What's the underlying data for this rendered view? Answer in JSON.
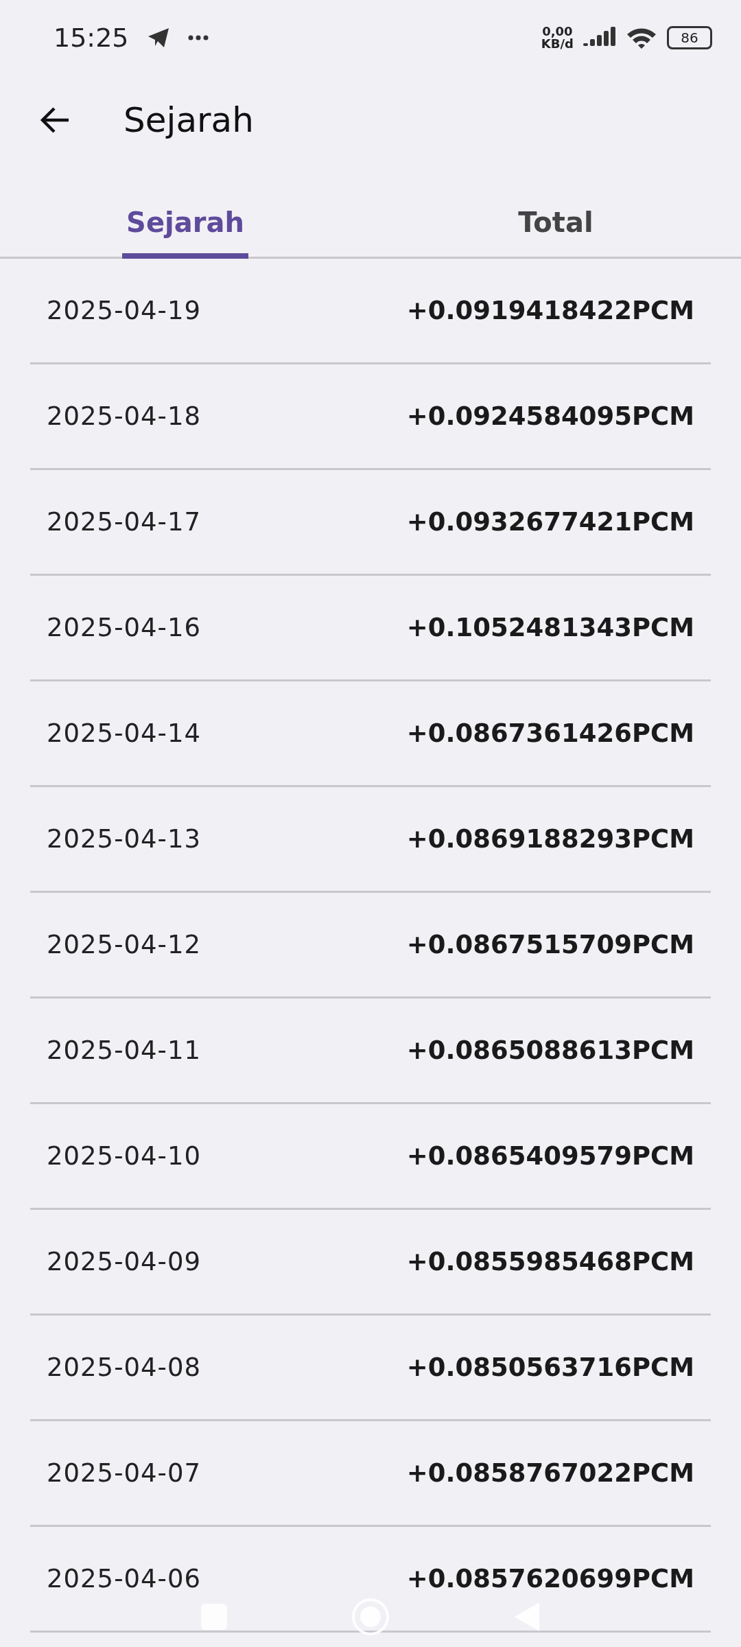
{
  "status_bar": {
    "time": "15:25",
    "net_speed": "0,00",
    "net_unit": "KB/d",
    "battery": "86"
  },
  "header": {
    "title": "Sejarah"
  },
  "tabs": [
    {
      "label": "Sejarah",
      "selected": true
    },
    {
      "label": "Total",
      "selected": false
    }
  ],
  "rows": [
    {
      "date": "2025-04-19",
      "amount": "+0.0919418422PCM"
    },
    {
      "date": "2025-04-18",
      "amount": "+0.0924584095PCM"
    },
    {
      "date": "2025-04-17",
      "amount": "+0.0932677421PCM"
    },
    {
      "date": "2025-04-16",
      "amount": "+0.1052481343PCM"
    },
    {
      "date": "2025-04-14",
      "amount": "+0.0867361426PCM"
    },
    {
      "date": "2025-04-13",
      "amount": "+0.0869188293PCM"
    },
    {
      "date": "2025-04-12",
      "amount": "+0.0867515709PCM"
    },
    {
      "date": "2025-04-11",
      "amount": "+0.0865088613PCM"
    },
    {
      "date": "2025-04-10",
      "amount": "+0.0865409579PCM"
    },
    {
      "date": "2025-04-09",
      "amount": "+0.0855985468PCM"
    },
    {
      "date": "2025-04-08",
      "amount": "+0.0850563716PCM"
    },
    {
      "date": "2025-04-07",
      "amount": "+0.0858767022PCM"
    },
    {
      "date": "2025-04-06",
      "amount": "+0.0857620699PCM"
    }
  ]
}
